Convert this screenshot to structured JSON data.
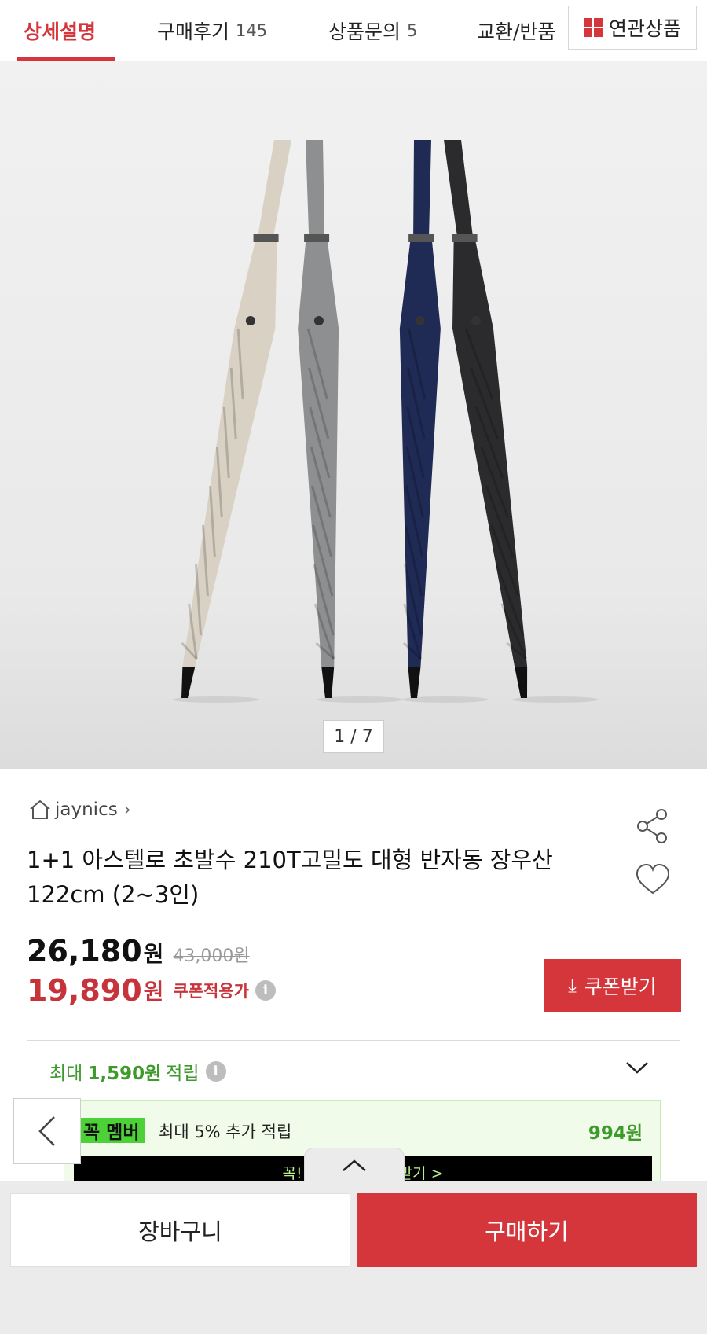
{
  "tabs": [
    {
      "label": "상세설명",
      "count": ""
    },
    {
      "label": "구매후기",
      "count": "145"
    },
    {
      "label": "상품문의",
      "count": "5"
    },
    {
      "label": "교환/반품",
      "count": ""
    }
  ],
  "related_button": {
    "label": "연관상품",
    "icon": "grid-icon"
  },
  "gallery": {
    "indicator": "1 / 7",
    "umbrella_colors": [
      "#d9d2c4",
      "#8e8f91",
      "#1f2a55",
      "#2b2b2d"
    ]
  },
  "product": {
    "shop_name": "jaynics",
    "title": "1+1 아스텔로 초발수 210T고밀도 대형 반자동 장우산 122cm (2~3인)",
    "price": "26,180",
    "price_unit": "원",
    "original_price": "43,000원",
    "coupon_price": "19,890",
    "coupon_price_unit": "원",
    "coupon_label": "쿠폰적용가",
    "coupon_button": "쿠폰받기"
  },
  "reward": {
    "prefix": "최대",
    "amount": "1,590원",
    "suffix": "적립",
    "member_badge": "꼭 멤버",
    "member_text": "최대 5% 추가 적립",
    "member_amount": "994원",
    "member_bar_text": "꼭! 시작하고 혜택 받기 >"
  },
  "bottom": {
    "cart_label": "장바구니",
    "buy_label": "구매하기"
  },
  "colors": {
    "accent": "#d5363b",
    "green": "#3f9a2c"
  }
}
